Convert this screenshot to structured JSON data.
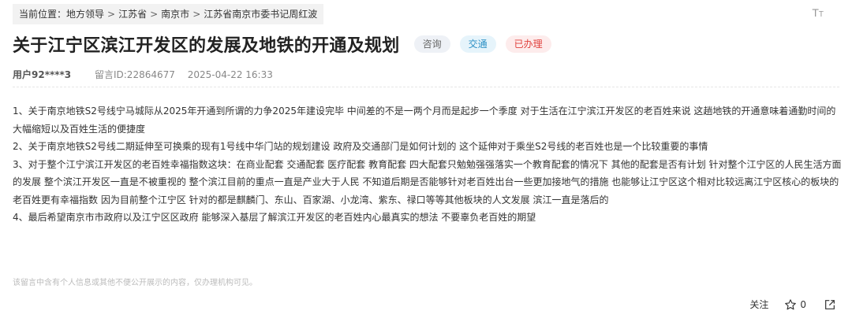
{
  "breadcrumb": {
    "prefix": "当前位置：",
    "items": [
      "地方领导",
      "江苏省",
      "南京市",
      "江苏省南京市委书记周红波"
    ],
    "separator": ">"
  },
  "font_toggle": {
    "large": "T",
    "small": "T"
  },
  "title": "关于江宁区滨江开发区的发展及地铁的开通及规划",
  "tags": [
    "咨询",
    "交通",
    "已办理"
  ],
  "meta": {
    "user": "用户92****3",
    "message_id": "留言ID:22864677",
    "datetime": "2025-04-22 16:33"
  },
  "content": [
    "1、关于南京地铁S2号线宁马城际从2025年开通到所谓的力争2025年建设完毕  中间差的不是一两个月而是起步一个季度 对于生活在江宁滨江开发区的老百姓来说  这趟地铁的开通意味着通勤时间的大幅缩短以及百姓生活的便捷度",
    "2、关于南京地铁S2号线二期延伸至可换乘的现有1号线中华门站的规划建设  政府及交通部门是如何计划的  这个延伸对于乘坐S2号线的老百姓也是一个比较重要的事情",
    "3、对于整个江宁滨江开发区的老百姓幸福指数这块：在商业配套 交通配套 医疗配套 教育配套 四大配套只勉勉强强落实一个教育配套的情况下 其他的配套是否有计划  针对整个江宁区的人民生活方面的发展 整个滨江开发区一直是不被重视的 整个滨江目前的重点一直是产业大于人民  不知道后期是否能够针对老百姓出台一些更加接地气的措施 也能够让江宁区这个相对比较远离江宁区核心的板块的老百姓更有幸福指数  因为目前整个江宁区 针对的都是麒麟门、东山、百家湖、小龙湾、紫东、禄口等等其他板块的人文发展 滨江一直是落后的",
    "4、最后希望南京市市政府以及江宁区区政府 能够深入基层了解滨江开发区的老百姓内心最真实的想法 不要辜负老百姓的期望"
  ],
  "notice": "该留言中含有个人信息或其他不便公开展示的内容，仅办理机构可见。",
  "actions": {
    "follow": "关注",
    "like_count": "0"
  },
  "icons": {
    "like": "star-icon",
    "share": "share-icon"
  }
}
